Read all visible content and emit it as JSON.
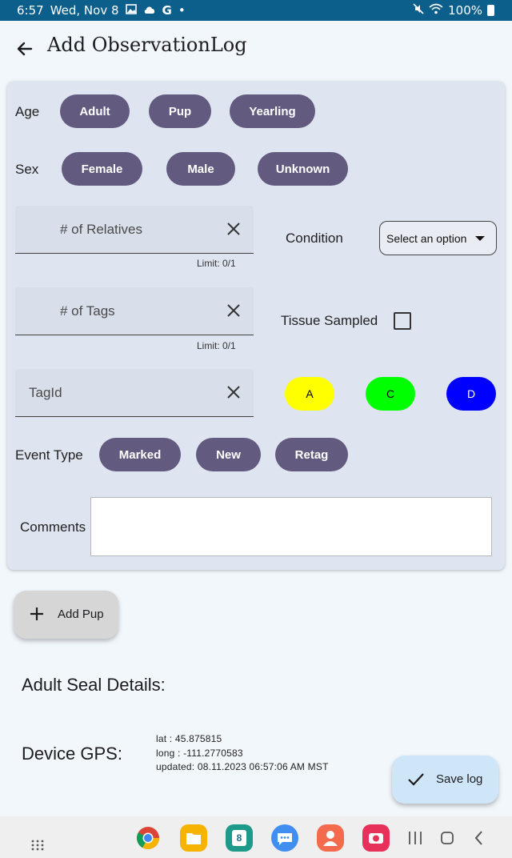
{
  "status_bar": {
    "time": "6:57",
    "date": "Wed, Nov 8",
    "battery": "100%",
    "left_icons": [
      "gallery-icon",
      "cloud-icon",
      "google-icon",
      "dot-icon"
    ],
    "right_icons": [
      "mute-icon",
      "wifi-icon",
      "battery-icon"
    ]
  },
  "header": {
    "title": "Add ObservationLog",
    "back_icon": "back-arrow-icon"
  },
  "form": {
    "age": {
      "label": "Age",
      "options": [
        "Adult",
        "Pup",
        "Yearling"
      ]
    },
    "sex": {
      "label": "Sex",
      "options": [
        "Female",
        "Male",
        "Unknown"
      ]
    },
    "relatives": {
      "label": "# of Relatives",
      "limit": "Limit: 0/1"
    },
    "tags": {
      "label": "# of Tags",
      "limit": "Limit: 0/1"
    },
    "tag_id": {
      "label": "TagId"
    },
    "condition": {
      "label": "Condition",
      "placeholder": "Select an option"
    },
    "tissue": {
      "label": "Tissue Sampled",
      "checked": false
    },
    "tag_colors": [
      {
        "label": "A",
        "color": "#ffff00",
        "text_color": "#000000"
      },
      {
        "label": "C",
        "color": "#00ff00",
        "text_color": "#000000"
      },
      {
        "label": "D",
        "color": "#0000ff",
        "text_color": "#ffffff"
      }
    ],
    "event_type": {
      "label": "Event Type",
      "options": [
        "Marked",
        "New",
        "Retag"
      ]
    },
    "comments": {
      "label": "Comments",
      "value": ""
    }
  },
  "add_pup": {
    "label": "Add Pup"
  },
  "adult_details": {
    "title": "Adult Seal Details:"
  },
  "gps": {
    "title": "Device GPS:",
    "lat": "lat : 45.875815",
    "long": "long : -111.2770583",
    "updated": "updated: 08.11.2023 06:57:06 AM MST"
  },
  "save": {
    "label": "Save log"
  },
  "nav_bar": {
    "icons": [
      "app-drawer-icon",
      "chrome-icon",
      "files-icon",
      "calendar-icon",
      "messages-icon",
      "contacts-icon",
      "camera-icon",
      "recents-icon",
      "home-icon",
      "back-icon"
    ],
    "calendar_day": "8"
  },
  "colors": {
    "chip": "#625b7f",
    "card": "#dfe5f0",
    "status_bar": "#0d5f8b",
    "save_button": "#cfe6f9"
  }
}
